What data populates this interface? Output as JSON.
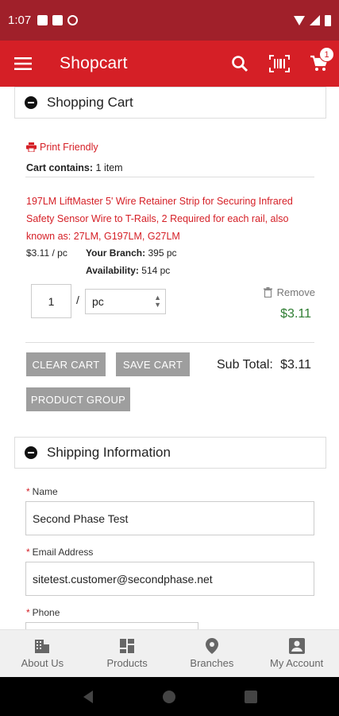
{
  "status_bar": {
    "time": "1:07"
  },
  "app_bar": {
    "title": "Shopcart",
    "cart_count": "1"
  },
  "cart_section": {
    "title": "Shopping Cart",
    "print_label": "Print Friendly",
    "contains_label": "Cart contains:",
    "contains_value": "1 item"
  },
  "item": {
    "title": "197LM LiftMaster 5' Wire Retainer Strip for Securing Infrared Safety Sensor Wire to T-Rails, 2 Required for each rail, also known as: 27LM, G197LM, G27LM",
    "price_unit": "$3.11 / pc",
    "branch_label": "Your Branch:",
    "branch_value": "395 pc",
    "availability_label": "Availability:",
    "availability_value": "514 pc",
    "quantity": "1",
    "slash": "/",
    "unit": "pc",
    "remove_label": "Remove",
    "line_total": "$3.11"
  },
  "actions": {
    "clear_label": "CLEAR CART",
    "save_label": "SAVE CART",
    "product_group_label": "PRODUCT GROUP",
    "subtotal_label": "Sub Total:",
    "subtotal_value": "$3.11"
  },
  "shipping": {
    "title": "Shipping Information",
    "name_label": "Name",
    "name_value": "Second Phase Test",
    "email_label": "Email Address",
    "email_value": "sitetest.customer@secondphase.net",
    "phone_label": "Phone",
    "required_mark": "*"
  },
  "bottom_nav": [
    {
      "label": "About Us",
      "icon": "building-icon"
    },
    {
      "label": "Products",
      "icon": "grid-icon"
    },
    {
      "label": "Branches",
      "icon": "map-pin-icon"
    },
    {
      "label": "My Account",
      "icon": "account-icon"
    }
  ],
  "colors": {
    "status_bar": "#a0202a",
    "app_bar": "#d51f26",
    "accent": "#d51f26",
    "price_green": "#2e7d32",
    "button_gray": "#9e9e9e"
  }
}
